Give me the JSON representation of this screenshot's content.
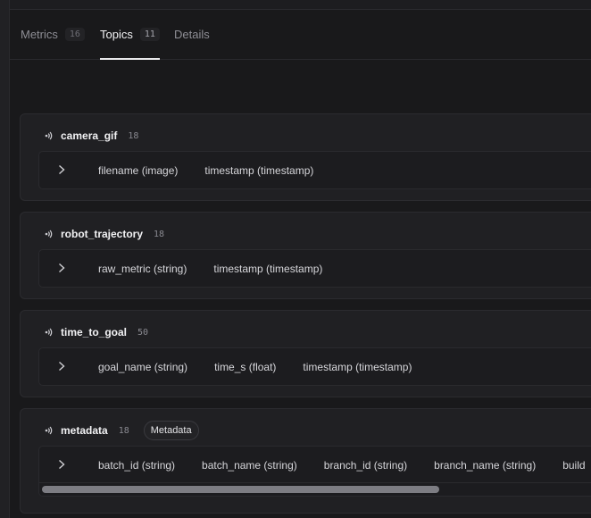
{
  "tabs": [
    {
      "label": "Metrics",
      "count": "16",
      "active": false
    },
    {
      "label": "Topics",
      "count": "11",
      "active": true
    },
    {
      "label": "Details",
      "active": false
    }
  ],
  "topics": [
    {
      "name": "camera_gif",
      "count": "18",
      "fields": [
        "filename (image)",
        "timestamp (timestamp)"
      ]
    },
    {
      "name": "robot_trajectory",
      "count": "18",
      "fields": [
        "raw_metric (string)",
        "timestamp (timestamp)"
      ]
    },
    {
      "name": "time_to_goal",
      "count": "50",
      "fields": [
        "goal_name (string)",
        "time_s (float)",
        "timestamp (timestamp)"
      ]
    },
    {
      "name": "metadata",
      "count": "18",
      "tag": "Metadata",
      "fields": [
        "batch_id (string)",
        "batch_name (string)",
        "branch_id (string)",
        "branch_name (string)",
        "build"
      ]
    }
  ],
  "scrollbar": {
    "thumb_fraction": 0.7
  }
}
